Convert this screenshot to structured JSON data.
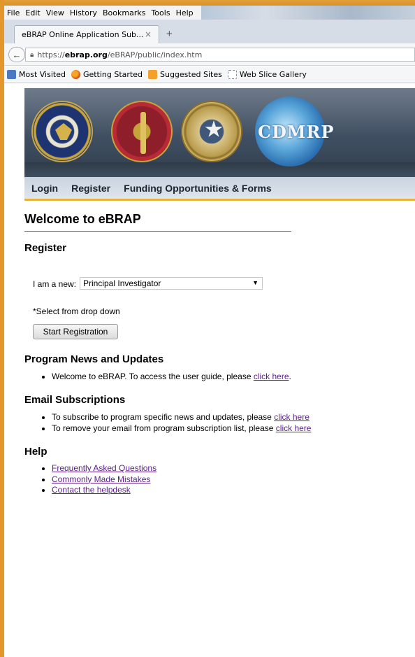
{
  "browser": {
    "menu": [
      "File",
      "Edit",
      "View",
      "History",
      "Bookmarks",
      "Tools",
      "Help"
    ],
    "tab_title": "eBRAP Online Application Sub...",
    "tab_close": "×",
    "new_tab": "+",
    "url_scheme": "https://",
    "url_host": "ebrap.org",
    "url_path": "/eBRAP/public/index.htm",
    "bookmarks": [
      "Most Visited",
      "Getting Started",
      "Suggested Sites",
      "Web Slice Gallery"
    ]
  },
  "banner": {
    "cdmrp_logo_text": "CDMRP"
  },
  "nav": {
    "login": "Login",
    "register": "Register",
    "funding": "Funding Opportunities & Forms"
  },
  "page": {
    "title": "Welcome to eBRAP"
  },
  "register": {
    "heading": "Register",
    "label": "I am a new:",
    "selected_role": "Principal Investigator",
    "hint": "*Select from drop down",
    "start_button": "Start Registration"
  },
  "news": {
    "heading": "Program News and Updates",
    "items": [
      {
        "text": "Welcome to eBRAP. To access the user guide, please ",
        "link": "click here",
        "suffix": "."
      }
    ]
  },
  "email": {
    "heading": "Email Subscriptions",
    "items": [
      {
        "text": "To subscribe to program specific news and updates, please ",
        "link": "click here"
      },
      {
        "text": "To remove your email from program subscription list, please ",
        "link": "click here"
      }
    ]
  },
  "help": {
    "heading": "Help",
    "links": [
      "Frequently Asked Questions",
      "Commonly Made Mistakes",
      "Contact the helpdesk"
    ]
  },
  "colors": {
    "frame": "#e3962a",
    "link": "#5b1f87",
    "nav_underline": "#e6b43a"
  }
}
